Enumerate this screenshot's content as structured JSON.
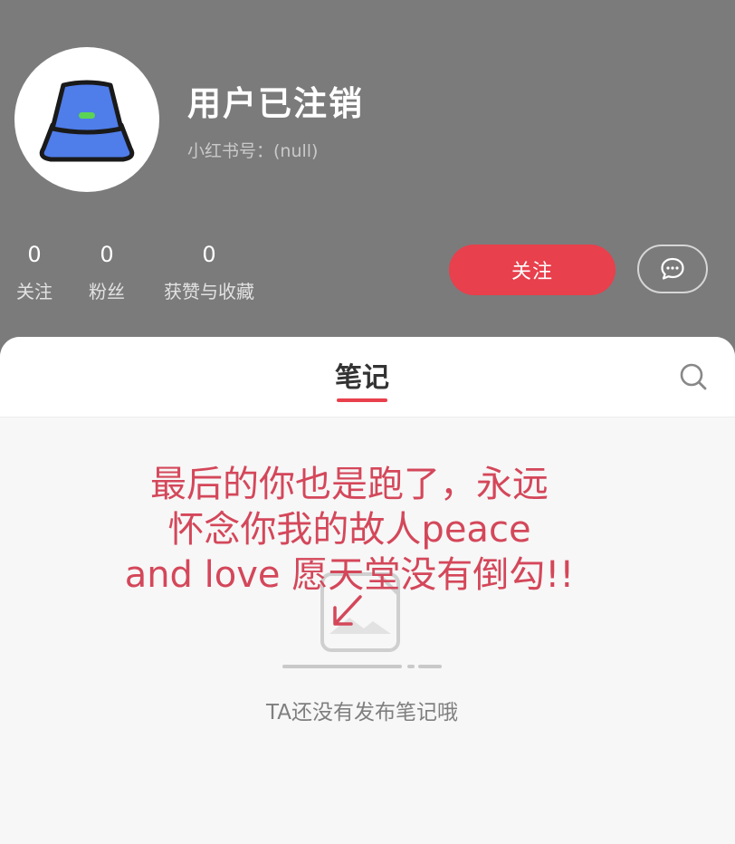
{
  "profile": {
    "username": "用户已注销",
    "red_id": "小红书号：(null)"
  },
  "stats": [
    {
      "value": "0",
      "label": "关注"
    },
    {
      "value": "0",
      "label": "粉丝"
    },
    {
      "value": "0",
      "label": "获赞与收藏"
    }
  ],
  "actions": {
    "follow_label": "关注",
    "message_icon": "chat-bubble-icon"
  },
  "tabs": {
    "notes_label": "笔记",
    "search_icon": "search-icon"
  },
  "empty_state": {
    "text": "TA还没有发布笔记哦"
  },
  "overlay_caption": {
    "lines": [
      "最后的你也是跑了，永远",
      "怀念你我的故人peace",
      "and love 愿天堂没有倒勾!!"
    ]
  },
  "colors": {
    "accent": "#e8404c",
    "header_bg": "#7b7b7b",
    "caption": "#d4475a"
  }
}
